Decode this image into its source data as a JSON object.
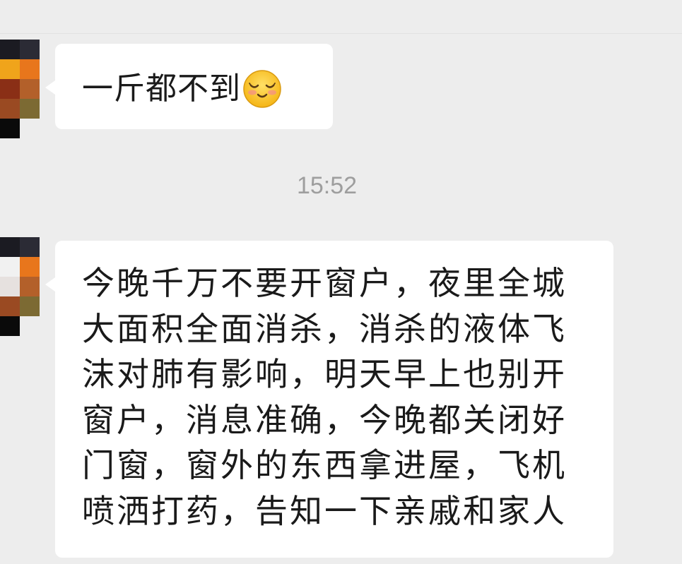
{
  "conversation": {
    "messages": [
      {
        "sender": "contact",
        "text": "一斤都不到",
        "emoji": "smiling-face-with-closed-eyes-emoji"
      },
      {
        "sender": "contact",
        "lines": [
          "今晚千万不要开窗户，夜里全城",
          "大面积全面消杀，消杀的液体飞",
          "沫对肺有影响，明天早上也别开",
          "窗户，消息准确，今晚都关闭好",
          "门窗，窗外的东西拿进屋，飞机",
          "喷洒打药，告知一下亲戚和家人"
        ]
      }
    ],
    "timestamp": "15:52"
  },
  "colors": {
    "background": "#ededed",
    "bubble": "#ffffff",
    "text": "#1a1a1a",
    "timestamp": "#9e9e9e"
  }
}
